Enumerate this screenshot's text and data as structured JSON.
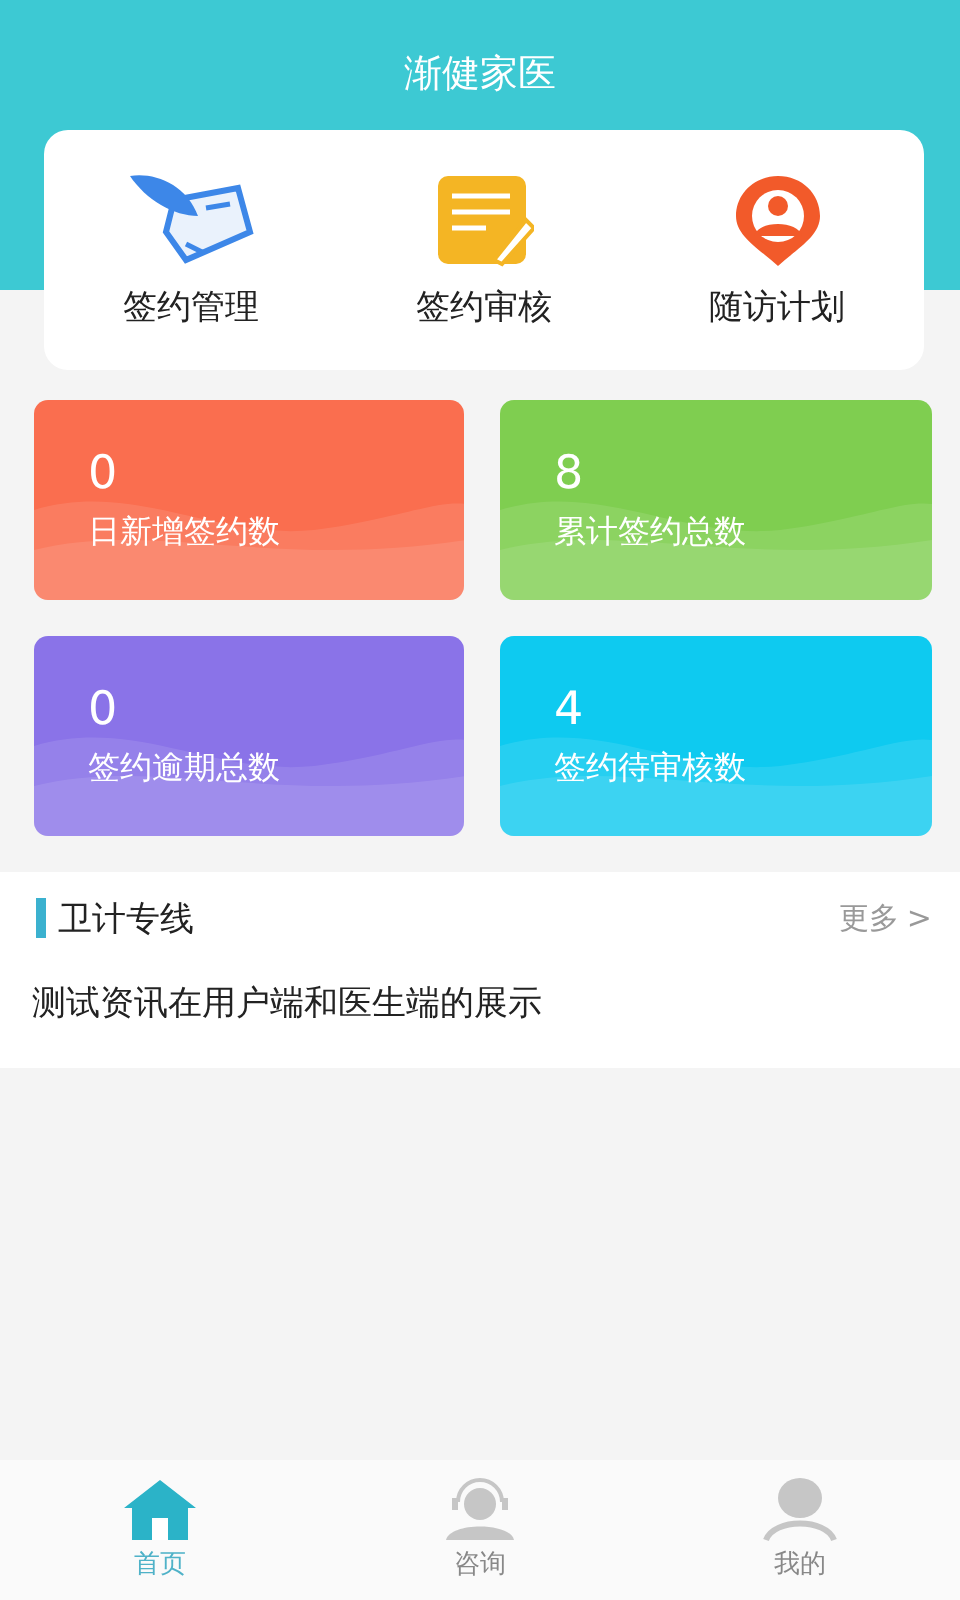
{
  "header": {
    "title": "渐健家医"
  },
  "shortcuts": [
    {
      "kind": "sign",
      "label": "签约管理"
    },
    {
      "kind": "review",
      "label": "签约审核"
    },
    {
      "kind": "visit",
      "label": "随访计划"
    }
  ],
  "stats": [
    {
      "value": "0",
      "label": "日新增签约数",
      "color": "#fa6e4f"
    },
    {
      "value": "8",
      "label": "累计签约总数",
      "color": "#7fce50"
    },
    {
      "value": "0",
      "label": "签约逾期总数",
      "color": "#8a73e8"
    },
    {
      "value": "4",
      "label": "签约待审核数",
      "color": "#0ecaf0"
    }
  ],
  "news": {
    "title": "卫计专线",
    "more": "更多",
    "more_icon": ">",
    "items": [
      "测试资讯在用户端和医生端的展示"
    ]
  },
  "nav": [
    {
      "kind": "home",
      "label": "首页",
      "selected": true
    },
    {
      "kind": "consult",
      "label": "咨询",
      "selected": false
    },
    {
      "kind": "me",
      "label": "我的",
      "selected": false
    }
  ]
}
